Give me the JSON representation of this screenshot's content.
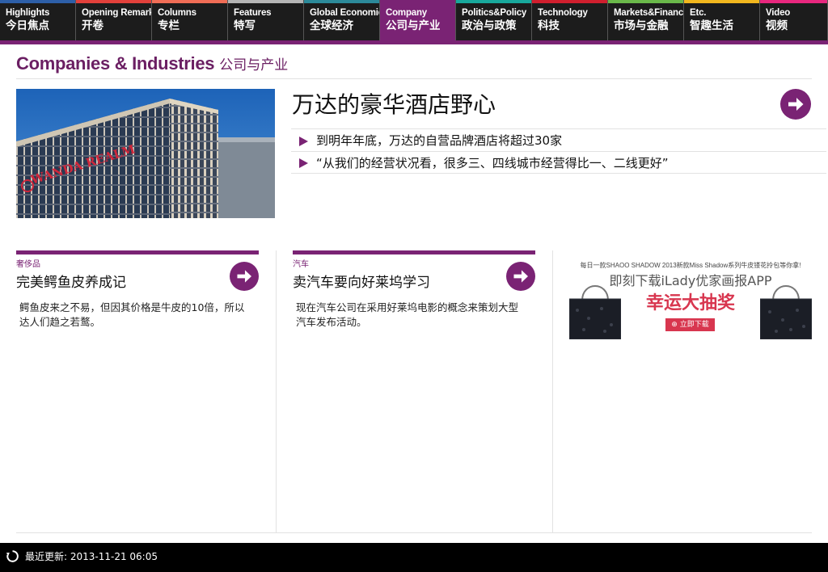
{
  "nav": {
    "tabs": [
      {
        "en": "Highlights",
        "zh": "今日焦点",
        "color": "#2d5fa8"
      },
      {
        "en": "Opening Remarks",
        "zh": "开卷",
        "color": "#e2403b"
      },
      {
        "en": "Columns",
        "zh": "专栏",
        "color": "#f06d56"
      },
      {
        "en": "Features",
        "zh": "特写",
        "color": "#b5b5b5"
      },
      {
        "en": "Global Economics",
        "zh": "全球经济",
        "color": "#2c8a9a"
      },
      {
        "en": "Company",
        "zh": "公司与产业",
        "color": "#7a2374"
      },
      {
        "en": "Politics&Policy",
        "zh": "政治与政策",
        "color": "#18a89c"
      },
      {
        "en": "Technology",
        "zh": "科技",
        "color": "#d01f2e"
      },
      {
        "en": "Markets&Finance",
        "zh": "市场与金融",
        "color": "#6ab84a"
      },
      {
        "en": "Etc.",
        "zh": "智趣生活",
        "color": "#f2b71e"
      },
      {
        "en": "Video",
        "zh": "视频",
        "color": "#e8277e"
      }
    ],
    "active_index": 5,
    "accent": "#7a2374"
  },
  "section": {
    "title_en": "Companies & Industries",
    "title_zh": "公司与产业"
  },
  "lead": {
    "title": "万达的豪华酒店野心",
    "image_sign": "WANDA REALM",
    "bullets": [
      "到明年年底，万达的自营品牌酒店将超过30家",
      "“从我们的经营状况看，很多三、四线城市经营得比一、二线更好”"
    ],
    "arrow_icon": "arrow-right-circle-icon"
  },
  "cards": [
    {
      "category": "奢侈品",
      "title": "完美鳄鱼皮养成记",
      "desc": "鳄鱼皮来之不易，但因其价格是牛皮的10倍，所以达人们趋之若鹜。"
    },
    {
      "category": "汽车",
      "title": "卖汽车要向好莱坞学习",
      "desc": "现在汽车公司在采用好莱坞电影的概念来策划大型汽车发布活动。"
    }
  ],
  "ad": {
    "small_text": "每日一款SHAOO SHADOW 2013新款Miss Shadow系列牛皮镂花拎包等你拿!",
    "line1": "即刻下载iLady优家画报APP",
    "line2": "幸运大抽奖",
    "download_label": "立即下载",
    "accent": "#d8364f"
  },
  "footer": {
    "updated_label": "最近更新: 2013-11-21 06:05",
    "refresh_icon": "refresh-icon"
  }
}
